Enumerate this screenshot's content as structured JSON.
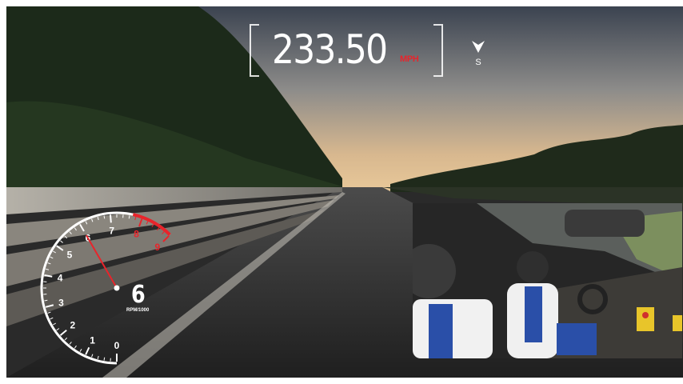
{
  "hud": {
    "speed_value": "233.50",
    "speed_unit": "MPH",
    "heading_letter": "S"
  },
  "tachometer": {
    "current_rpm_label": "6",
    "unit_label": "RPM/1000",
    "ticks": [
      "0",
      "1",
      "2",
      "3",
      "4",
      "5",
      "6",
      "7",
      "8",
      "9"
    ],
    "redline_ticks": [
      "8",
      "9"
    ],
    "needle_value": 6
  },
  "colors": {
    "accent_red": "#e8242b",
    "hud_white": "#ffffff"
  }
}
